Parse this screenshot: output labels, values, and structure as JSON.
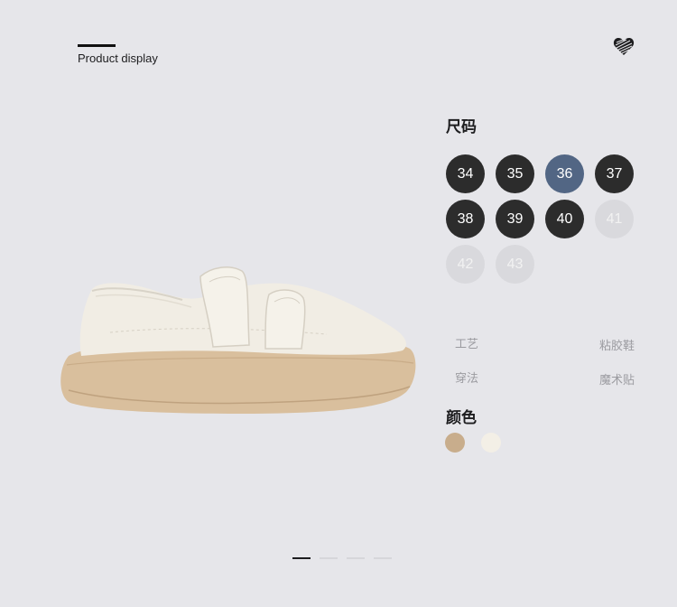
{
  "header": {
    "title": "Product display",
    "icon": "heart-icon"
  },
  "product": {
    "image_desc": "white-velcro-sneaker-image"
  },
  "size": {
    "label": "尺码",
    "options": [
      {
        "value": "34",
        "state": "normal"
      },
      {
        "value": "35",
        "state": "normal"
      },
      {
        "value": "36",
        "state": "selected"
      },
      {
        "value": "37",
        "state": "normal"
      },
      {
        "value": "38",
        "state": "normal"
      },
      {
        "value": "39",
        "state": "normal"
      },
      {
        "value": "40",
        "state": "normal"
      },
      {
        "value": "41",
        "state": "disabled"
      },
      {
        "value": "42",
        "state": "disabled"
      },
      {
        "value": "43",
        "state": "disabled"
      }
    ]
  },
  "specs": [
    {
      "key": "工艺",
      "value": "粘胶鞋"
    },
    {
      "key": "穿法",
      "value": "魔术贴"
    }
  ],
  "color": {
    "label": "颜色",
    "swatches": [
      "#c8ad8c",
      "#f3efe6"
    ]
  },
  "pager": {
    "total": 4,
    "active": 1
  }
}
